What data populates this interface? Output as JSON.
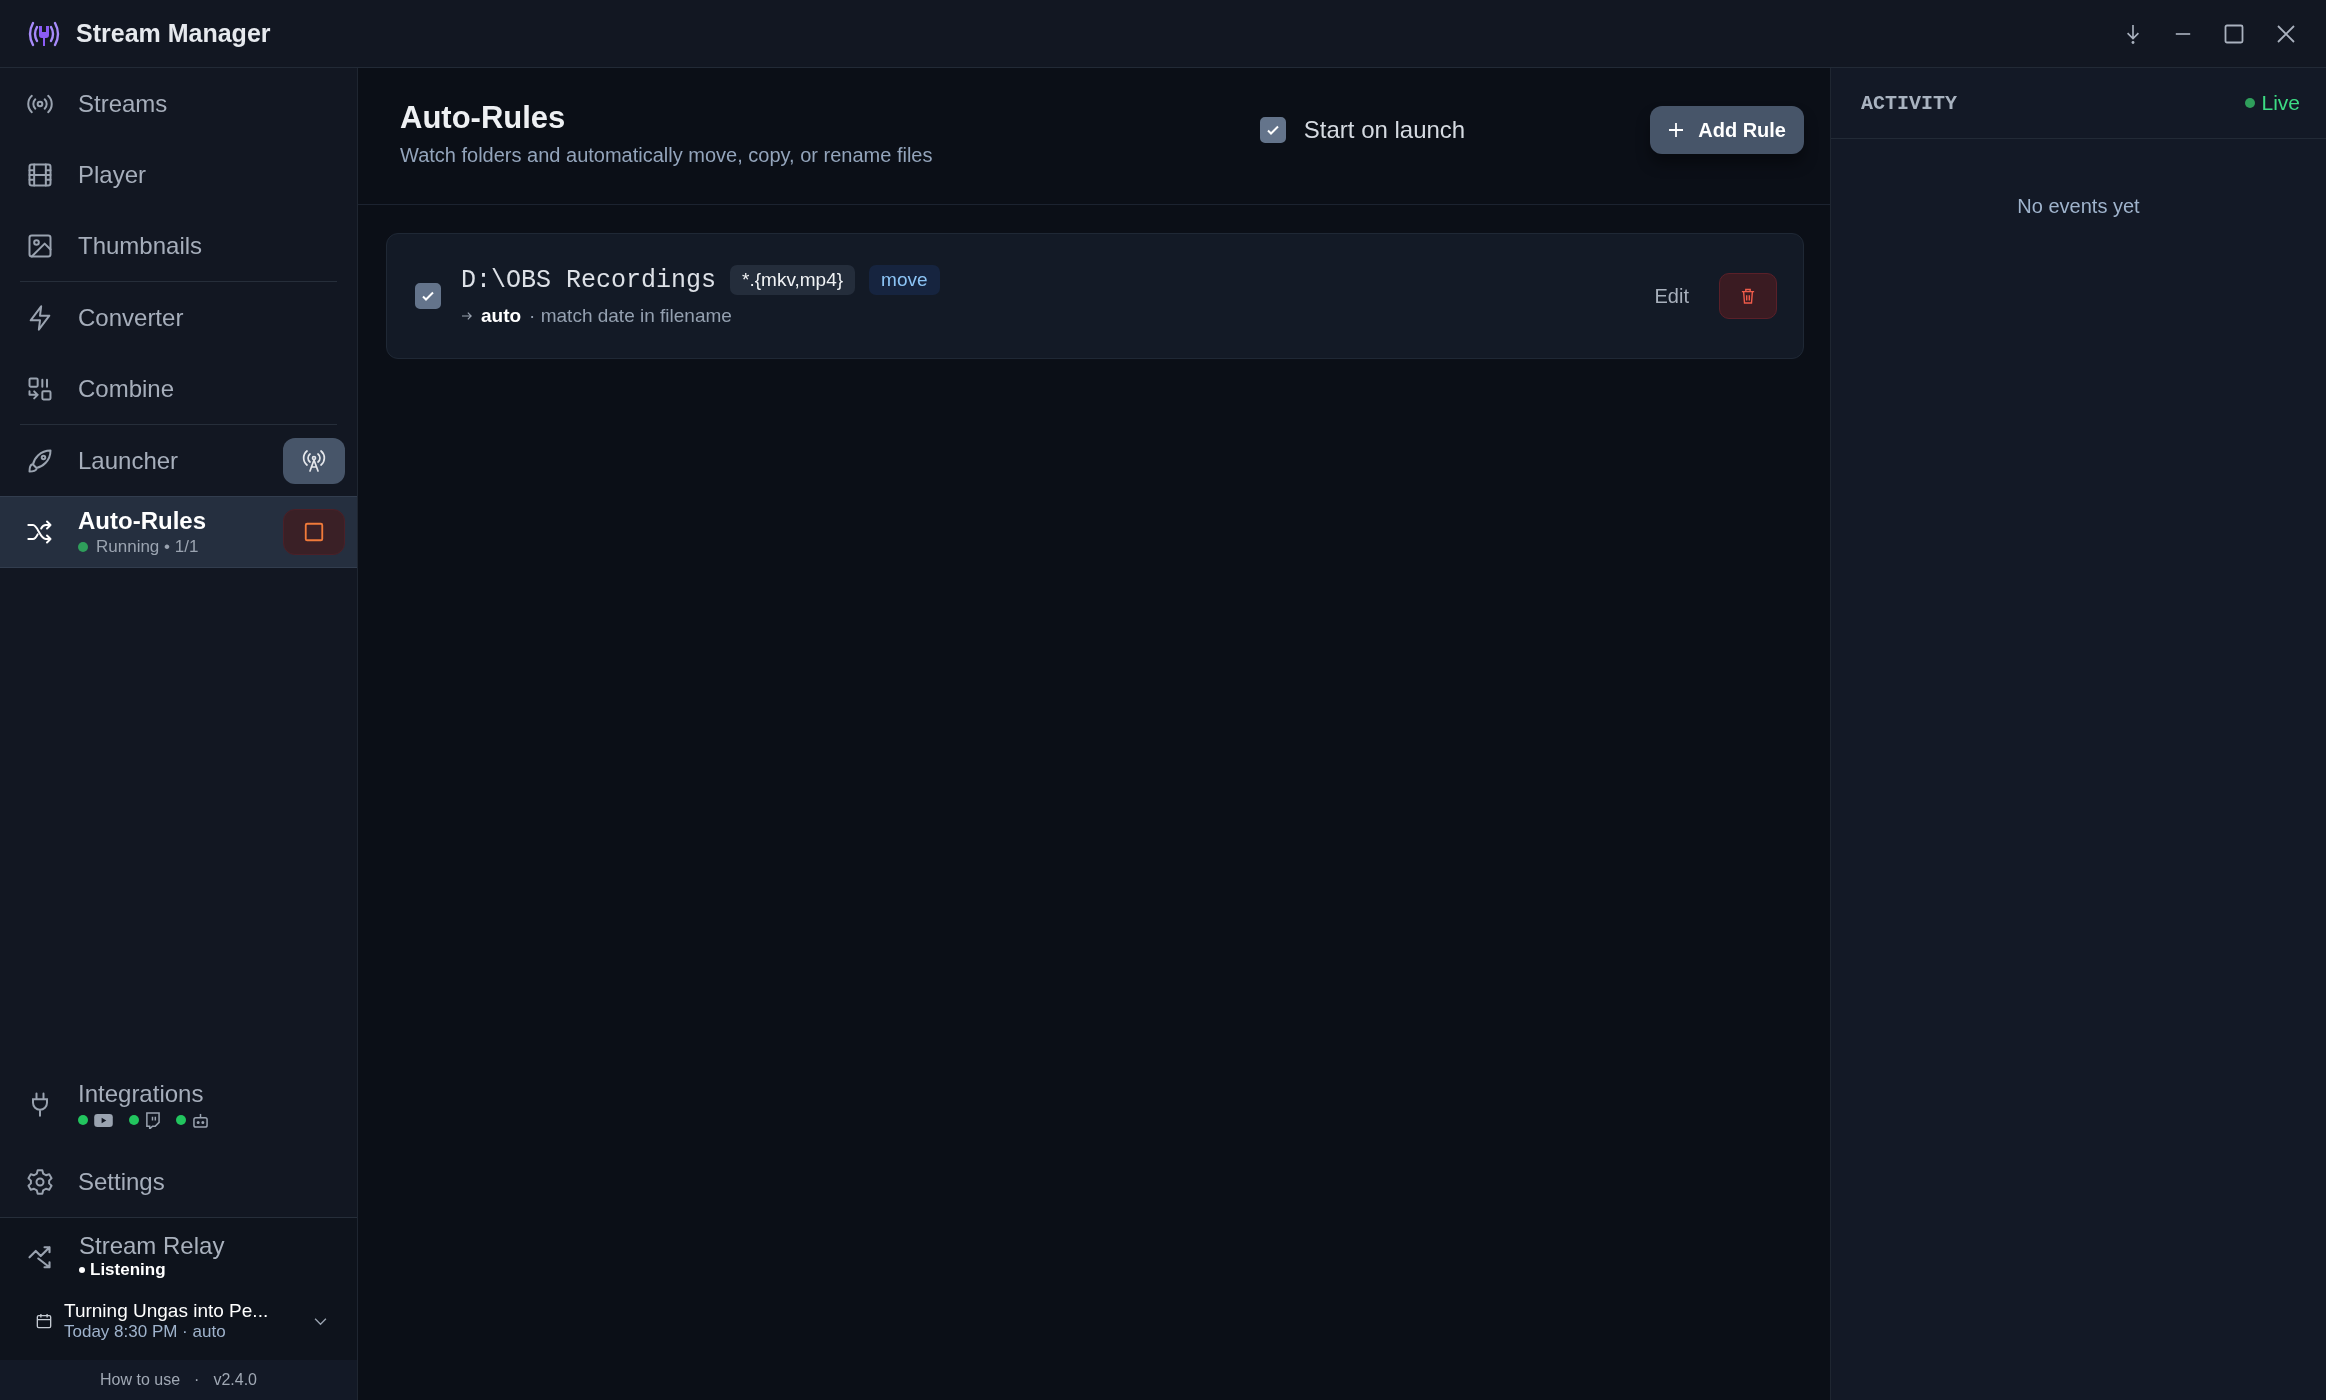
{
  "window": {
    "title": "Stream Manager"
  },
  "sidebar": {
    "groups": [
      [
        {
          "label": "Streams",
          "kind": "streams",
          "selected": false
        },
        {
          "label": "Player",
          "kind": "player",
          "selected": false
        },
        {
          "label": "Thumbnails",
          "kind": "thumbnails",
          "selected": false
        }
      ],
      [
        {
          "label": "Converter",
          "kind": "converter",
          "selected": false
        },
        {
          "label": "Combine",
          "kind": "combine",
          "selected": false
        }
      ],
      [
        {
          "label": "Launcher",
          "kind": "launcher",
          "selected": false
        },
        {
          "label": "Auto-Rules",
          "kind": "rules",
          "selected": true,
          "status": "Running • 1/1",
          "running": true
        }
      ]
    ],
    "integrations": {
      "label": "Integrations",
      "services": [
        {
          "kind": "video",
          "connected": true
        },
        {
          "kind": "chat",
          "connected": true
        },
        {
          "kind": "bot",
          "connected": true
        }
      ]
    },
    "settings": {
      "label": "Settings"
    },
    "relay": {
      "title": "Stream Relay",
      "status": "Listening",
      "schedule": {
        "title": "Turning Ungas into Pe...",
        "meta": "Today 8:30 PM · auto"
      }
    },
    "footer": {
      "link": "How to use",
      "separator": "·",
      "version": "v2.4.0"
    }
  },
  "header": {
    "title": "Auto-Rules",
    "subtitle": "Watch folders and automatically move, copy, or rename files",
    "start_on_launch": {
      "label": "Start on launch",
      "checked": true
    },
    "add_button": "Add Rule"
  },
  "rules": [
    {
      "enabled": true,
      "path": "D:\\OBS Recordings",
      "pattern": "*.{mkv,mp4}",
      "action": "move",
      "destination": "auto",
      "note": "· match date in filename",
      "edit": "Edit"
    }
  ],
  "activity": {
    "title": "ACTIVITY",
    "live": "Live",
    "empty": "No events yet"
  }
}
